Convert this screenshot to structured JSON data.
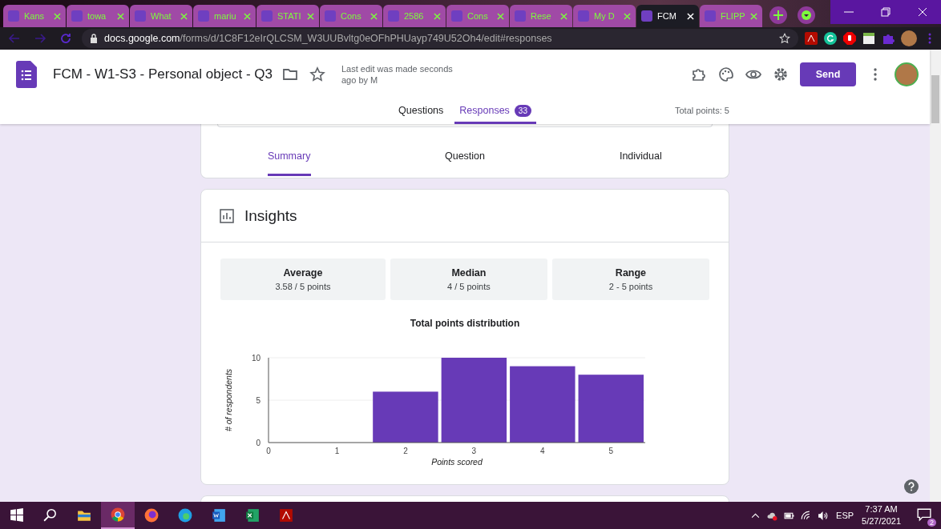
{
  "browser": {
    "tabs": [
      {
        "title": "Kans",
        "selected": false
      },
      {
        "title": "towa",
        "selected": false
      },
      {
        "title": "What",
        "selected": false
      },
      {
        "title": "mariu",
        "selected": false
      },
      {
        "title": "STATI",
        "selected": false
      },
      {
        "title": "Cons",
        "selected": false
      },
      {
        "title": "2586",
        "selected": false
      },
      {
        "title": "Cons",
        "selected": false
      },
      {
        "title": "Rese",
        "selected": false
      },
      {
        "title": "My D",
        "selected": false
      },
      {
        "title": "FCM",
        "selected": true
      },
      {
        "title": "FLIPP",
        "selected": false
      }
    ],
    "url_host": "docs.google.com",
    "url_path": "/forms/d/1C8F12eIrQLCSM_W3UUBvltg0eOFhPHUayp749U52Oh4/edit#responses"
  },
  "form": {
    "title": "FCM - W1-S3 - Personal object - Q3",
    "last_edit": "Last edit was made seconds ago by M",
    "send": "Send",
    "tabs": [
      {
        "label": "Questions",
        "selected": false
      },
      {
        "label": "Responses",
        "badge": "33",
        "selected": true
      }
    ],
    "total_points": "Total points: 5"
  },
  "view_tabs": [
    {
      "label": "Summary",
      "selected": true
    },
    {
      "label": "Question",
      "selected": false
    },
    {
      "label": "Individual",
      "selected": false
    }
  ],
  "insights": {
    "title": "Insights",
    "stats": [
      {
        "label": "Average",
        "value": "3.58 / 5 points"
      },
      {
        "label": "Median",
        "value": "4 / 5 points"
      },
      {
        "label": "Range",
        "value": "2 - 5 points"
      }
    ],
    "chart_data": {
      "type": "bar",
      "title": "Total points distribution",
      "xlabel": "Points scored",
      "ylabel": "# of respondents",
      "x": [
        2,
        3,
        4,
        5
      ],
      "values": [
        6,
        10,
        9,
        8
      ],
      "xlim": [
        0,
        5.5
      ],
      "ylim": [
        0,
        10
      ],
      "xticks": [
        0,
        1,
        2,
        3,
        4,
        5
      ],
      "yticks": [
        0,
        5,
        10
      ]
    }
  },
  "taskbar": {
    "language": "ESP",
    "time": "7:37 AM",
    "date": "5/27/2021",
    "notifications": "2"
  }
}
